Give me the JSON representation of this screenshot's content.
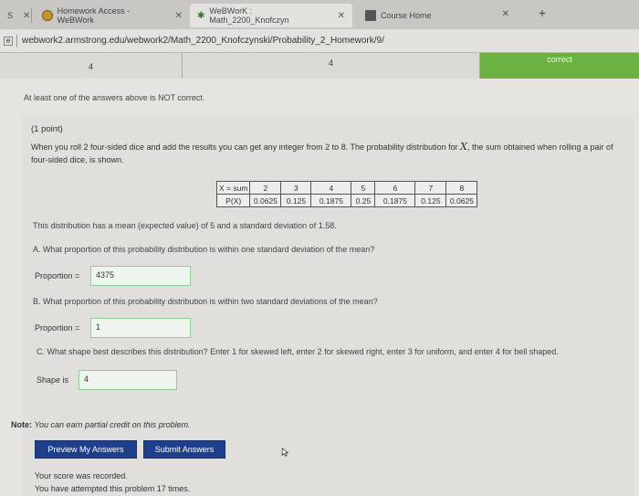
{
  "browser": {
    "tabs": [
      {
        "label": "S",
        "active": false
      },
      {
        "label": "Homework Access - WeBWork",
        "active": false
      },
      {
        "label": "WeBWorK : Math_2200_Knofczyn",
        "active": true
      },
      {
        "label": "Course Home",
        "active": false
      }
    ],
    "url": "webwork2.armstrong.edu/webwork2/Math_2200_Knofczynski/Probability_2_Homework/9/"
  },
  "results": {
    "cells": [
      "4",
      "4",
      "correct"
    ],
    "correct_color": "#6bb243"
  },
  "warning": "At least one of the answers above is NOT correct.",
  "problem": {
    "points": "(1 point)",
    "statement_part1": "When you roll 2 four-sided dice and add the results you can get any integer from 2 to 8. The probability distribution for",
    "statement_var": "X",
    "statement_part2": ", the sum obtained when rolling a pair of four-sided dice, is shown.",
    "table": {
      "header_label": "X = sum",
      "x_values": [
        "2",
        "3",
        "4",
        "5",
        "6",
        "7",
        "8"
      ],
      "prob_label": "P(X)",
      "p_values": [
        "0.0625",
        "0.125",
        "0.1875",
        "0.25",
        "0.1875",
        "0.125",
        "0.0625"
      ]
    },
    "mean_sd_text": "This distribution has a mean (expected value) of 5 and a standard deviation of 1.58.",
    "qA": "A. What proportion of this probability distribution is within one standard deviation of the mean?",
    "qA_label": "Proportion =",
    "qA_value": "4375",
    "qB": "B. What proportion of this probability distribution is within two standard deviations of the mean?",
    "qB_label": "Proportion =",
    "qB_value": "1",
    "qC": "C. What shape best describes this distribution? Enter 1 for skewed left, enter 2 for skewed right, enter 3 for uniform, and enter 4 for bell shaped.",
    "qC_label": "Shape is",
    "qC_value": "4",
    "note_label": "Note:",
    "note_text": "You can earn partial credit on this problem."
  },
  "buttons": {
    "preview": "Preview My Answers",
    "submit": "Submit Answers"
  },
  "footer": {
    "score": "Your score was recorded.",
    "attempts": "You have attempted this problem 17 times."
  }
}
